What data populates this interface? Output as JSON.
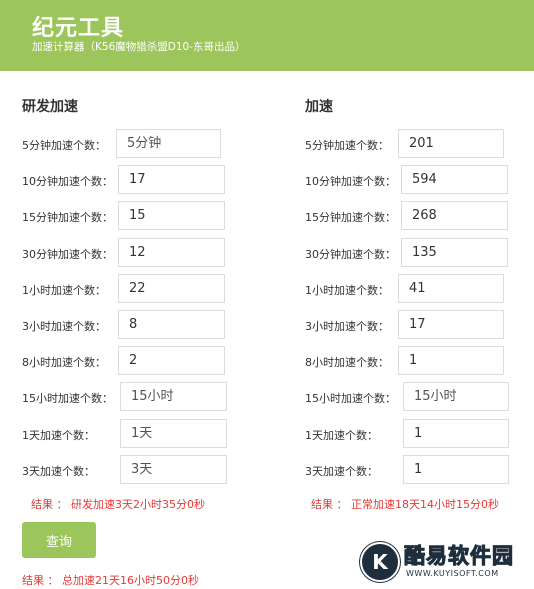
{
  "header": {
    "title": "纪元工具",
    "subtitle": "加速计算器（K56魔物猎杀盟D10-东哥出品）"
  },
  "left": {
    "title": "研发加速",
    "rows": [
      {
        "label": "5分钟加速个数：",
        "value": "",
        "placeholder": "5分钟"
      },
      {
        "label": "10分钟加速个数：",
        "value": "17",
        "placeholder": ""
      },
      {
        "label": "15分钟加速个数：",
        "value": "15",
        "placeholder": ""
      },
      {
        "label": "30分钟加速个数：",
        "value": "12",
        "placeholder": ""
      },
      {
        "label": "1小时加速个数：",
        "value": "22",
        "placeholder": ""
      },
      {
        "label": "3小时加速个数：",
        "value": "8",
        "placeholder": ""
      },
      {
        "label": "8小时加速个数：",
        "value": "2",
        "placeholder": ""
      },
      {
        "label": "15小时加速个数：",
        "value": "",
        "placeholder": "15小时"
      },
      {
        "label": "1天加速个数：",
        "value": "",
        "placeholder": "1天"
      },
      {
        "label": "3天加速个数：",
        "value": "",
        "placeholder": "3天"
      }
    ],
    "result": "结果 ： 研发加速3天2小时35分0秒"
  },
  "right": {
    "title": "加速",
    "rows": [
      {
        "label": "5分钟加速个数：",
        "value": "201",
        "placeholder": ""
      },
      {
        "label": "10分钟加速个数：",
        "value": "594",
        "placeholder": ""
      },
      {
        "label": "15分钟加速个数：",
        "value": "268",
        "placeholder": ""
      },
      {
        "label": "30分钟加速个数：",
        "value": "135",
        "placeholder": ""
      },
      {
        "label": "1小时加速个数：",
        "value": "41",
        "placeholder": ""
      },
      {
        "label": "3小时加速个数：",
        "value": "17",
        "placeholder": ""
      },
      {
        "label": "8小时加速个数：",
        "value": "1",
        "placeholder": ""
      },
      {
        "label": "15小时加速个数：",
        "value": "",
        "placeholder": "15小时"
      },
      {
        "label": "1天加速个数：",
        "value": "1",
        "placeholder": ""
      },
      {
        "label": "3天加速个数：",
        "value": "1",
        "placeholder": ""
      }
    ],
    "result": "结果 ： 正常加速18天14小时15分0秒"
  },
  "query_button": "查询",
  "total_result": "结果 ： 总加速21天16小时50分0秒",
  "watermark": {
    "logo_icon": "k-logo-icon",
    "logo_letter": "K",
    "name": "酷易软件园",
    "url": "WWW.KUYISOFT.COM"
  },
  "colors": {
    "accent": "#9cc55c",
    "result": "#e53935"
  }
}
